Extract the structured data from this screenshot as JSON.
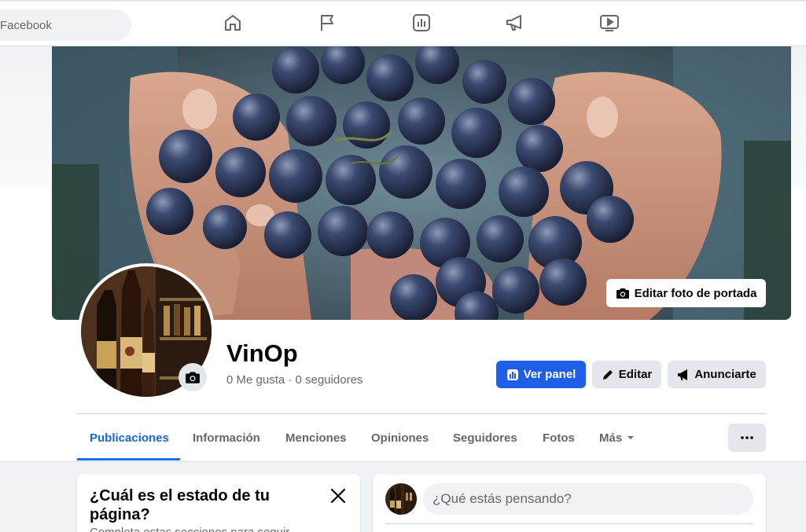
{
  "topbar": {
    "search_placeholder": "Facebook",
    "nav_icons": [
      "home-icon",
      "flag-icon",
      "insights-icon",
      "megaphone-icon",
      "video-icon"
    ]
  },
  "cover": {
    "edit_label": "Editar foto de portada"
  },
  "profile": {
    "name": "VinOp",
    "stats": "0 Me gusta · 0 seguidores"
  },
  "actions": {
    "panel_label": "Ver panel",
    "edit_label": "Editar",
    "ads_label": "Anunciarte"
  },
  "tabs": [
    {
      "label": "Publicaciones",
      "active": true
    },
    {
      "label": "Información"
    },
    {
      "label": "Menciones"
    },
    {
      "label": "Opiniones"
    },
    {
      "label": "Seguidores"
    },
    {
      "label": "Fotos"
    },
    {
      "label": "Más"
    }
  ],
  "status_card": {
    "title": "¿Cuál es el estado de tu página?",
    "subtitle": "Completa estas secciones para seguir"
  },
  "composer": {
    "placeholder": "¿Qué estás pensando?"
  },
  "colors": {
    "accent": "#1b74e4",
    "button_gray": "#e4e6eb",
    "text_secondary": "#65676b"
  }
}
